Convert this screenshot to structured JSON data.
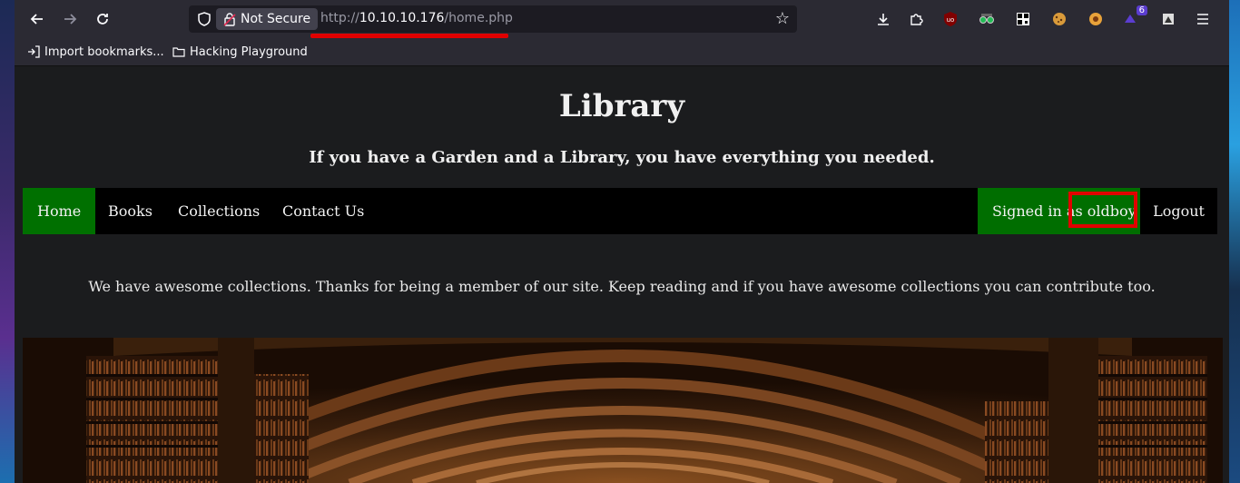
{
  "browser": {
    "security_label": "Not Secure",
    "url_scheme": "http://",
    "url_host": "10.10.10.176",
    "url_path": "/home.php",
    "extension_badge": "6",
    "bookmarks": [
      {
        "label": "Import bookmarks..."
      },
      {
        "label": "Hacking Playground"
      }
    ]
  },
  "site": {
    "title": "Library",
    "tagline": "If you have a Garden and a Library, you have everything you needed.",
    "nav": {
      "home": "Home",
      "books": "Books",
      "collections": "Collections",
      "contact": "Contact Us",
      "signed_in": "Signed in as oldboy",
      "logout": "Logout"
    },
    "message": "We have awesome collections. Thanks for being a member of our site. Keep reading and if you have awesome collections you can contribute too."
  },
  "colors": {
    "nav_active": "#007000",
    "annotation": "#e00000"
  }
}
